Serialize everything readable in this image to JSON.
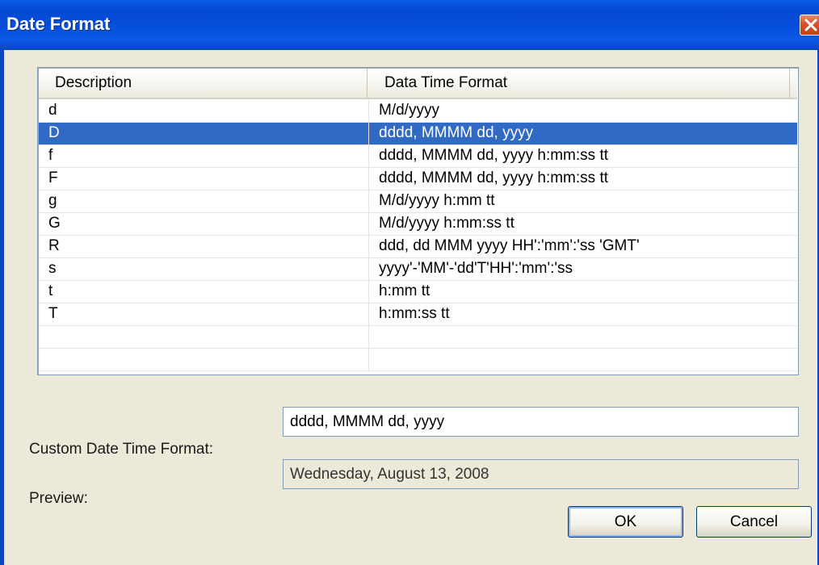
{
  "window": {
    "title": "Date Format"
  },
  "grid": {
    "columns": [
      "Description",
      "Data Time Format"
    ],
    "rows": [
      {
        "description": "d",
        "format": "M/d/yyyy",
        "selected": false
      },
      {
        "description": "D",
        "format": "dddd, MMMM dd, yyyy",
        "selected": true
      },
      {
        "description": "f",
        "format": "dddd, MMMM dd, yyyy h:mm:ss tt",
        "selected": false
      },
      {
        "description": "F",
        "format": "dddd, MMMM dd, yyyy h:mm:ss tt",
        "selected": false
      },
      {
        "description": "g",
        "format": "M/d/yyyy h:mm tt",
        "selected": false
      },
      {
        "description": "G",
        "format": "M/d/yyyy h:mm:ss tt",
        "selected": false
      },
      {
        "description": "R",
        "format": "ddd, dd MMM yyyy HH':'mm':'ss 'GMT'",
        "selected": false
      },
      {
        "description": "s",
        "format": "yyyy'-'MM'-'dd'T'HH':'mm':'ss",
        "selected": false
      },
      {
        "description": "t",
        "format": "h:mm tt",
        "selected": false
      },
      {
        "description": "T",
        "format": "h:mm:ss tt",
        "selected": false
      },
      {
        "description": "",
        "format": "",
        "selected": false
      },
      {
        "description": "",
        "format": "",
        "selected": false
      }
    ]
  },
  "form": {
    "custom_label": "Custom Date Time  Format:",
    "custom_value": "dddd, MMMM dd, yyyy",
    "preview_label": "Preview:",
    "preview_value": "Wednesday, August 13, 2008"
  },
  "buttons": {
    "ok": "OK",
    "cancel": "Cancel"
  },
  "colors": {
    "title_bar": "#0550dc",
    "selection": "#316ac5",
    "window_bg": "#ece9d8"
  }
}
